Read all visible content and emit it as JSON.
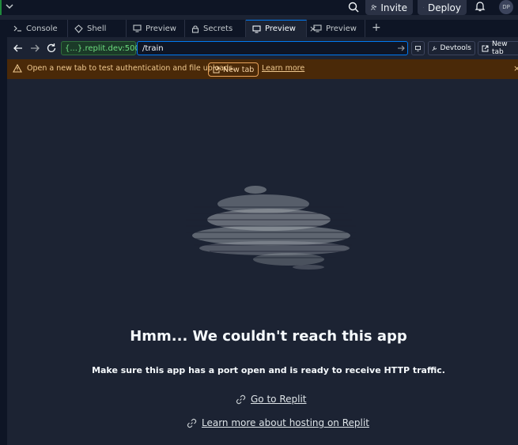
{
  "topbar": {
    "invite_label": "Invite",
    "deploy_label": "Deploy",
    "avatar_initials": "DP"
  },
  "tabs": [
    {
      "label": "Console",
      "icon": "terminal-icon"
    },
    {
      "label": "Shell",
      "icon": "shell-icon"
    },
    {
      "label": "Preview",
      "icon": "monitor-icon"
    },
    {
      "label": "Secrets",
      "icon": "lock-icon"
    },
    {
      "label": "Preview",
      "icon": "monitor-icon",
      "active": true
    },
    {
      "label": "Preview",
      "icon": "monitor-icon"
    }
  ],
  "urlbar": {
    "origin": "{...}.replit.dev:5000",
    "path": "/train",
    "devtools_label": "Devtools",
    "newtab_label": "New tab"
  },
  "banner": {
    "message": "Open a new tab to test authentication and file uploads.",
    "newtab_label": "New tab",
    "learn_more_label": "Learn more"
  },
  "main": {
    "title": "Hmm... We couldn't reach this app",
    "subtitle": "Make sure this app has a port open and is ready to receive HTTP traffic.",
    "link1": "Go to Replit",
    "link2": "Learn more about hosting on Replit"
  },
  "colors": {
    "background": "#1c2333",
    "chrome": "#0e1525",
    "accent": "#0079f2",
    "warning_bg": "#4a2908",
    "origin_green": "#6ddc7f"
  }
}
